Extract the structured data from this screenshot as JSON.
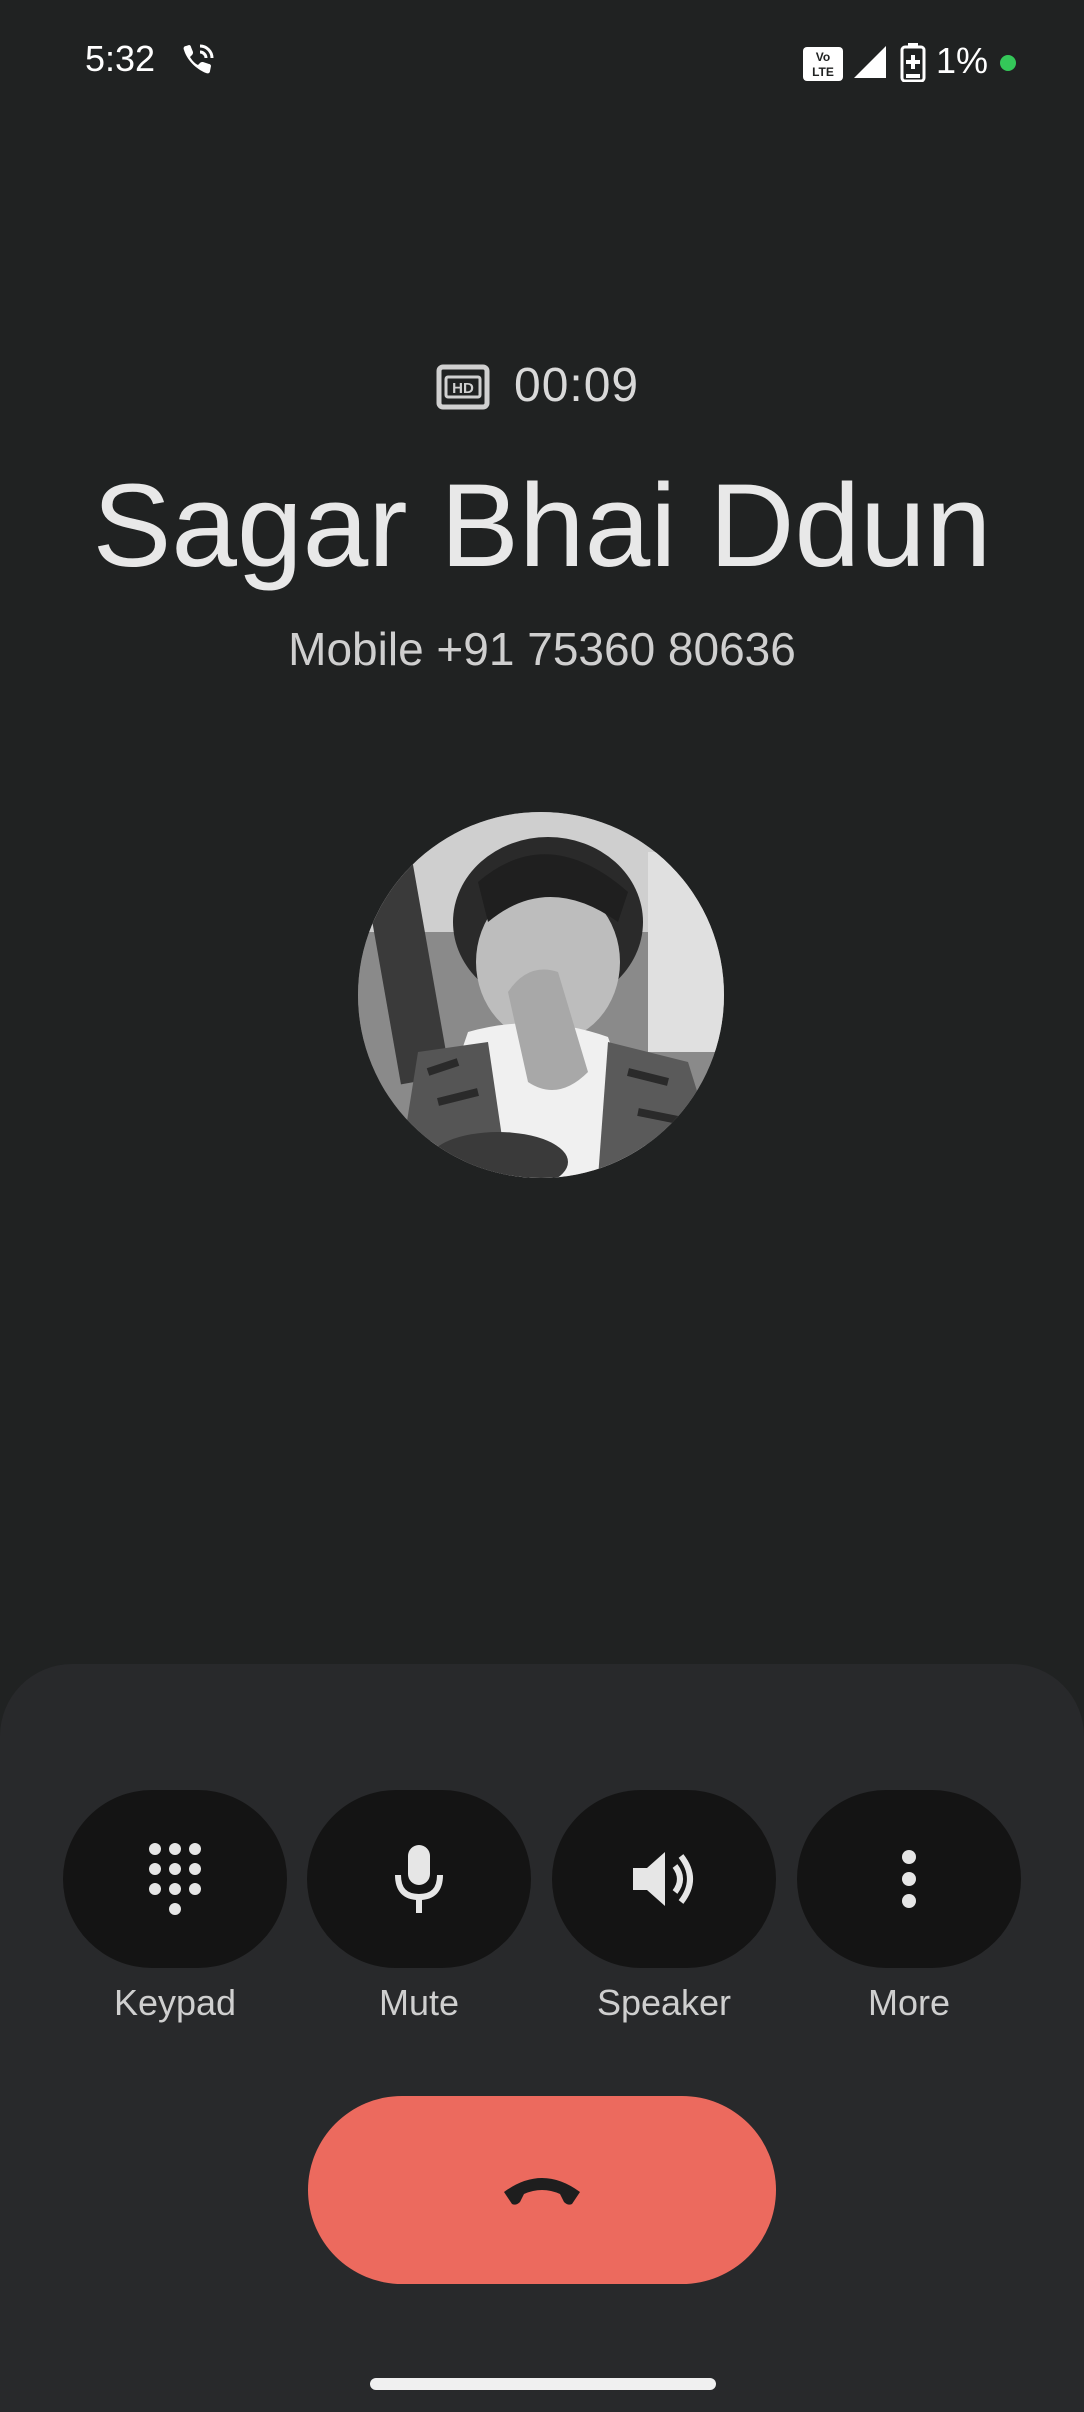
{
  "status_bar": {
    "time": "5:32",
    "network_badge": "Vo LTE",
    "battery_percent": "1%",
    "icons": [
      "wifi-calling-icon",
      "volte-icon",
      "signal-icon",
      "battery-charging-icon",
      "privacy-indicator-dot"
    ]
  },
  "call": {
    "quality_badge": "HD",
    "timer": "00:09",
    "contact_name": "Sagar Bhai Ddun",
    "number_line": "Mobile +91 75360 80636"
  },
  "controls": {
    "keypad_label": "Keypad",
    "mute_label": "Mute",
    "speaker_label": "Speaker",
    "more_label": "More"
  },
  "colors": {
    "background": "#202222",
    "sheet": "#28292b",
    "button": "#141414",
    "end_call": "#ec6a5e",
    "privacy_dot": "#34c759"
  }
}
